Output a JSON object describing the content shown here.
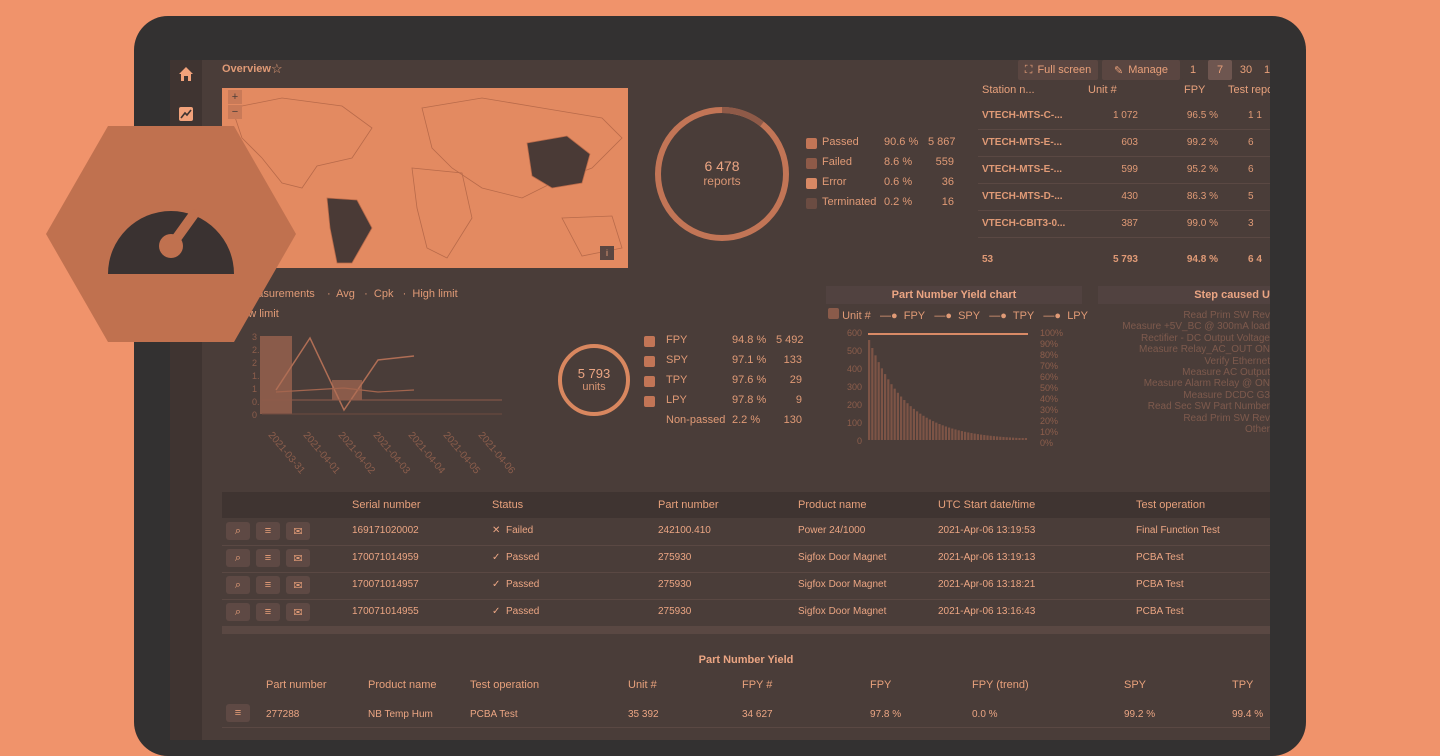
{
  "topbar": {
    "title": "Overview",
    "fullscreen_label": "Full screen",
    "manage_label": "Manage",
    "period_buttons": [
      "1",
      "7",
      "30",
      "1"
    ]
  },
  "donut_reports": {
    "count": "6 478",
    "unit": "reports",
    "legend": [
      {
        "label": "Passed",
        "percent": "90.6 %",
        "count": "5 867",
        "color": "#c27556"
      },
      {
        "label": "Failed",
        "percent": "8.6 %",
        "count": "559",
        "color": "#8e5a48"
      },
      {
        "label": "Error",
        "percent": "0.6 %",
        "count": "36",
        "color": "#d88864"
      },
      {
        "label": "Terminated",
        "percent": "0.2 %",
        "count": "16",
        "color": "#6b4c42"
      }
    ]
  },
  "station_table": {
    "headers": [
      "Station n...",
      "Unit #",
      "FPY",
      "Test repo"
    ],
    "rows": [
      {
        "station": "VTECH-MTS-C-...",
        "units": "1 072",
        "fpy": "96.5 %",
        "reports": "1 1"
      },
      {
        "station": "VTECH-MTS-E-...",
        "units": "603",
        "fpy": "99.2 %",
        "reports": "6"
      },
      {
        "station": "VTECH-MTS-E-...",
        "units": "599",
        "fpy": "95.2 %",
        "reports": "6"
      },
      {
        "station": "VTECH-MTS-D-...",
        "units": "430",
        "fpy": "86.3 %",
        "reports": "5"
      },
      {
        "station": "VTECH-CBIT3-0...",
        "units": "387",
        "fpy": "99.0 %",
        "reports": "3"
      }
    ],
    "footer": {
      "station": "53",
      "units": "5 793",
      "fpy": "94.8 %",
      "reports": "6 4"
    }
  },
  "measure_chart": {
    "legend": [
      "Measurements",
      "Avg",
      "Cpk",
      "High limit"
    ],
    "low_limit_label": "Low limit",
    "y_label": "Measurements",
    "y2_label": "Cpk",
    "y_ticks": [
      "3",
      "2.5",
      "2",
      "1.5",
      "1",
      "0.5",
      "0"
    ],
    "x_ticks": [
      "2021-03-31",
      "2021-04-01",
      "2021-04-02",
      "2021-04-03",
      "2021-04-04",
      "2021-04-05",
      "2021-04-06"
    ]
  },
  "donut_units": {
    "count": "5 793",
    "unit": "units",
    "legend": [
      {
        "label": "FPY",
        "percent": "94.8 %",
        "count": "5 492"
      },
      {
        "label": "SPY",
        "percent": "97.1 %",
        "count": "133"
      },
      {
        "label": "TPY",
        "percent": "97.6 %",
        "count": "29"
      },
      {
        "label": "LPY",
        "percent": "97.8 %",
        "count": "9"
      },
      {
        "label": "Non-passed",
        "percent": "2.2 %",
        "count": "130"
      }
    ]
  },
  "yield_chart": {
    "title": "Part Number Yield chart",
    "legend": [
      "Unit #",
      "FPY",
      "SPY",
      "TPY",
      "LPY"
    ],
    "y_ticks": [
      "600",
      "500",
      "400",
      "300",
      "200",
      "100",
      "0"
    ],
    "y2_ticks": [
      "100%",
      "90%",
      "80%",
      "70%",
      "60%",
      "50%",
      "40%",
      "30%",
      "20%",
      "10%",
      "0%"
    ],
    "y_label": "Unit #",
    "y2_label": "Yield"
  },
  "step_panel": {
    "title": "Step caused U",
    "items": [
      "Read Prim SW Rev",
      "Measure +5V_BC @ 300mA load",
      "Rectifier - DC Output Voltage",
      "Measure Relay_AC_OUT ON",
      "Verify Ethernet",
      "Measure AC Output",
      "Measure Alarm Relay @ ON",
      "Measure DCDC G3",
      "Read Sec SW Part Number",
      "Read Prim SW Rev",
      "Other"
    ]
  },
  "serial_table": {
    "headers": [
      "Serial number",
      "Status",
      "Part number",
      "Product name",
      "UTC Start date/time",
      "Test operation"
    ],
    "rows": [
      {
        "serial": "169171020002",
        "status": "Failed",
        "status_icon": "✕",
        "part": "242100.410",
        "product": "Power 24/1000",
        "date": "2021-Apr-06 13:19:53",
        "operation": "Final Function Test"
      },
      {
        "serial": "170071014959",
        "status": "Passed",
        "status_icon": "✓",
        "part": "275930",
        "product": "Sigfox Door Magnet",
        "date": "2021-Apr-06 13:19:13",
        "operation": "PCBA Test"
      },
      {
        "serial": "170071014957",
        "status": "Passed",
        "status_icon": "✓",
        "part": "275930",
        "product": "Sigfox Door Magnet",
        "date": "2021-Apr-06 13:18:21",
        "operation": "PCBA Test"
      },
      {
        "serial": "170071014955",
        "status": "Passed",
        "status_icon": "✓",
        "part": "275930",
        "product": "Sigfox Door Magnet",
        "date": "2021-Apr-06 13:16:43",
        "operation": "PCBA Test"
      }
    ]
  },
  "pn_yield": {
    "title": "Part Number Yield",
    "headers": [
      "Part number",
      "Product name",
      "Test operation",
      "Unit #",
      "FPY #",
      "FPY",
      "FPY (trend)",
      "SPY",
      "TPY"
    ],
    "row": {
      "part": "277288",
      "product": "NB Temp Hum",
      "operation": "PCBA Test",
      "units": "35 392",
      "fpy_count": "34 627",
      "fpy": "97.8 %",
      "trend": "0.0 %",
      "spy": "99.2 %",
      "tpy": "99.4 %"
    }
  },
  "colors": {
    "background": "#f0936b",
    "screen": "#4a3d39",
    "accent": "#e9a07a"
  }
}
